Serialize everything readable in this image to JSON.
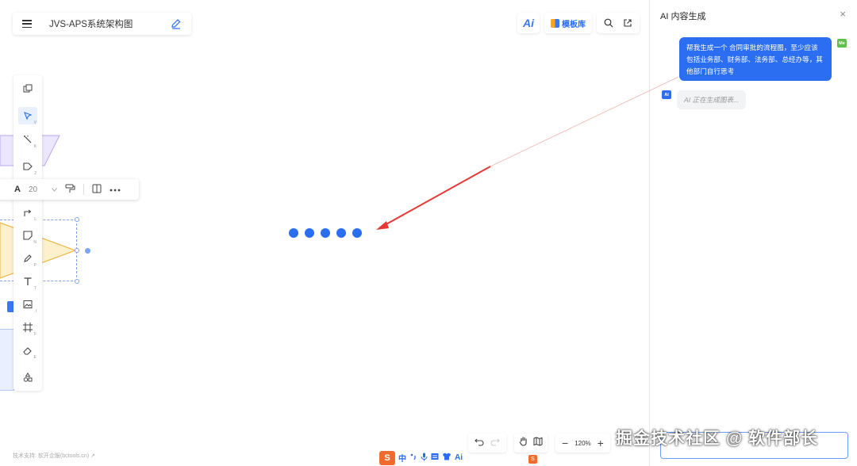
{
  "header": {
    "doc_title": "JVS-APS系统架构图"
  },
  "toolbar_top": {
    "ai_label": "Ai",
    "template_label": "模板库"
  },
  "format_bar": {
    "font_label": "A",
    "font_size": "20"
  },
  "footer": {
    "support_text": "技术支持: 软开企服(bctools.cn) ↗"
  },
  "zoom": {
    "level": "120%",
    "minus": "−",
    "plus": "+"
  },
  "ime": {
    "logo": "S",
    "lang": "中",
    "ai": "Ai"
  },
  "panel": {
    "title": "AI 内容生成",
    "close": "×",
    "user_avatar": "Me",
    "user_message": "帮我生成一个 合同审批的流程图，至少应该包括业务部、财务部、法务部、总经办等，其他部门自行思考",
    "ai_avatar": "AI",
    "ai_message": "AI 正在生成图表..."
  },
  "watermark": "掘金技术社区 @ 软件部长",
  "colors": {
    "accent": "#2c6ef2",
    "arrow": "#e53935",
    "shape_fill_yellow": "#fdf0cc",
    "shape_fill_purple": "#ece6ff"
  },
  "icons": {
    "left_tools": [
      "layers-icon",
      "pointer-icon",
      "magic-wand-icon",
      "shape-icon",
      "connector-icon",
      "sticky-note-icon",
      "pen-icon",
      "text-icon",
      "image-icon",
      "frame-icon",
      "eraser-icon",
      "more-shapes-icon"
    ],
    "top_tools": [
      "search-icon",
      "share-icon"
    ],
    "bottom_tools": [
      "undo-icon",
      "redo-icon",
      "hand-icon",
      "map-icon"
    ]
  }
}
